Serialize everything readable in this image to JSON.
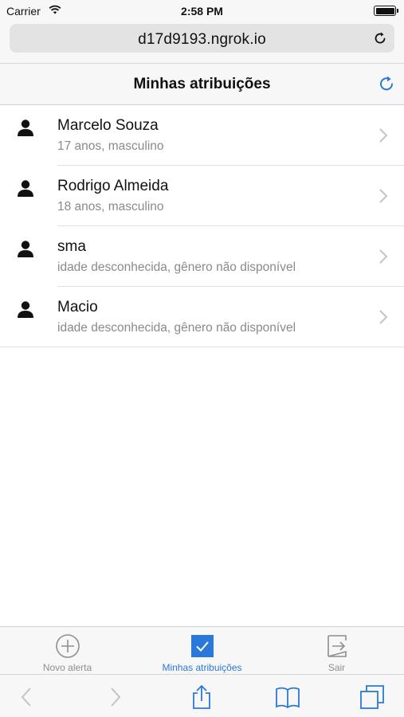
{
  "status_bar": {
    "carrier": "Carrier",
    "time": "2:58 PM"
  },
  "browser": {
    "url": "d17d9193.ngrok.io"
  },
  "header": {
    "title": "Minhas atribuições"
  },
  "assignments": [
    {
      "name": "Marcelo Souza",
      "details": "17 anos, masculino"
    },
    {
      "name": "Rodrigo Almeida",
      "details": "18 anos, masculino"
    },
    {
      "name": "sma",
      "details": "idade desconhecida, gênero não disponível"
    },
    {
      "name": "Macio",
      "details": "idade desconhecida, gênero não disponível"
    }
  ],
  "tabs": [
    {
      "label": "Novo alerta",
      "icon": "plus-circle-icon"
    },
    {
      "label": "Minhas atribuições",
      "icon": "checkbox-icon",
      "active": true
    },
    {
      "label": "Sair",
      "icon": "exit-icon"
    }
  ],
  "colors": {
    "accent": "#2a78d9",
    "secondary_text": "#8a8a8a",
    "chrome_bg": "#f7f7f7"
  }
}
